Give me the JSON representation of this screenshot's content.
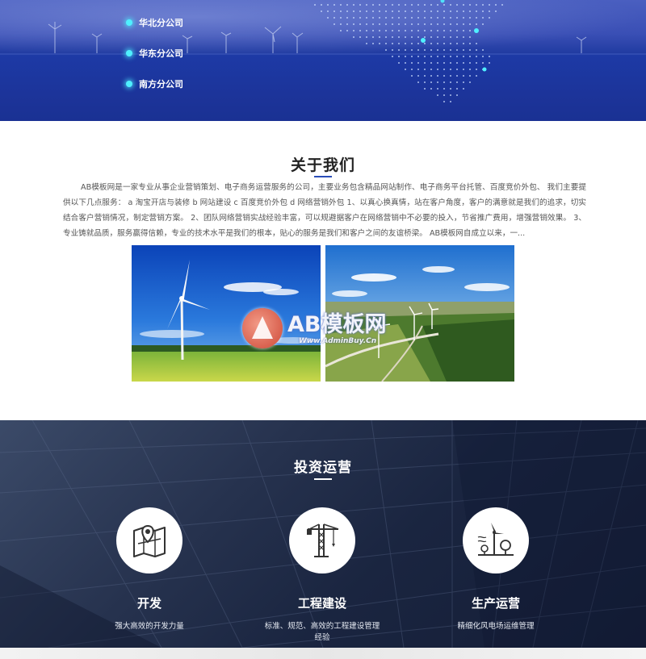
{
  "banner": {
    "branches": [
      {
        "label": "华北分公司"
      },
      {
        "label": "华东分公司"
      },
      {
        "label": "南方分公司"
      }
    ]
  },
  "about": {
    "title": "关于我们",
    "description": "AB模板网是一家专业从事企业营销策划、电子商务运营服务的公司，主要业务包含精品网站制作、电子商务平台托管、百度竞价外包、 我们主要提供以下几点服务： a 淘宝开店与装修 b 网站建设 c 百度竞价外包 d 网络营销外包 1、以真心换真情，站在客户角度，客户的满意就是我们的追求，切实结合客户营销情况，制定营销方案。 2、团队网络营销实战经验丰富，可以规避据客户在网络营销中不必要的投入，节省推广费用，增强营销效果。 3、专业铸就品质，服务赢得信赖，专业的技术水平是我们的根本，贴心的服务是我们和客户之间的友谊桥梁。 AB模板网自成立以来，一...",
    "watermark": {
      "text": "AB模板网",
      "url": "Www.AdminBuy.Cn"
    }
  },
  "invest": {
    "title": "投资运营",
    "cards": [
      {
        "name": "开发",
        "sub": "强大高效的开发力量",
        "icon": "map-pin-icon"
      },
      {
        "name": "工程建设",
        "sub": "标准、规范、高效的工程建设管理经验",
        "icon": "tower-crane-icon"
      },
      {
        "name": "生产运营",
        "sub": "精细化风电场运维管理",
        "icon": "wind-turbine-icon"
      }
    ]
  },
  "colors": {
    "accent": "#2a4db8",
    "banner_blue": "#1f3aa0",
    "glow_dot": "#4ff0ff",
    "invest_dark": "#1a2540"
  }
}
